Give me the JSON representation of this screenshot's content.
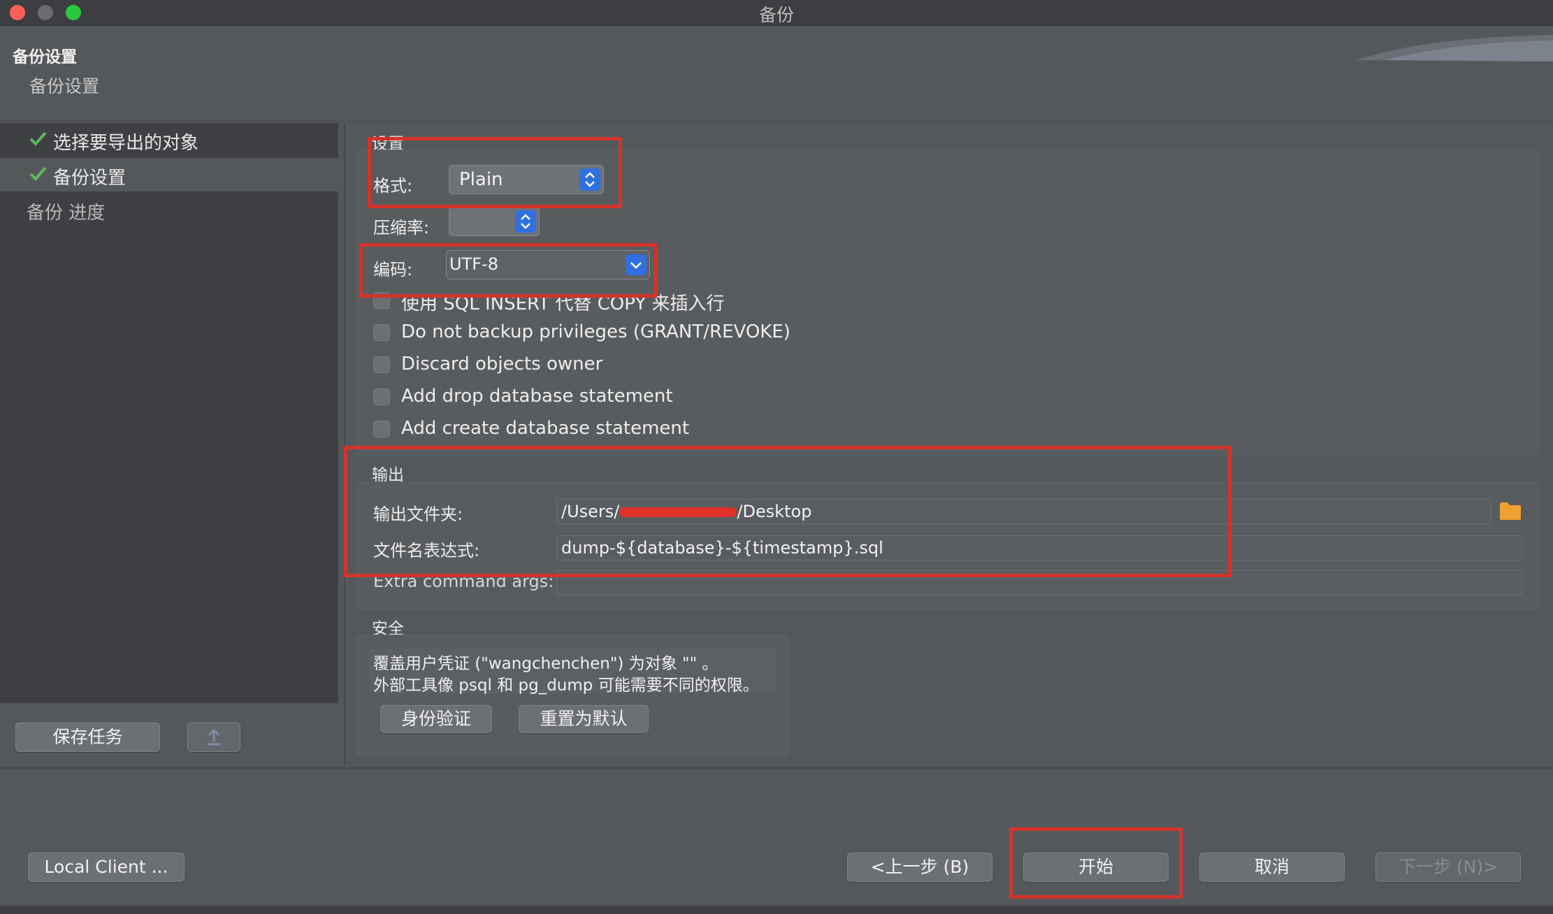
{
  "window": {
    "title": "备份"
  },
  "header": {
    "title": "备份设置",
    "subtitle": "备份设置"
  },
  "nav": {
    "items": [
      {
        "label": "选择要导出的对象",
        "done": true
      },
      {
        "label": "备份设置",
        "done": true
      },
      {
        "label": "备份 进度",
        "done": false
      }
    ],
    "save_task_label": "保存任务"
  },
  "settings": {
    "group_title": "设置",
    "format_label": "格式:",
    "format_value": "Plain",
    "compression_label": "压缩率:",
    "compression_value": "",
    "encoding_label": "编码:",
    "encoding_value": "UTF-8",
    "checkboxes": [
      {
        "label": "使用 SQL INSERT 代替 COPY 来插入行",
        "checked": false
      },
      {
        "label": "Do not backup privileges (GRANT/REVOKE)",
        "checked": false
      },
      {
        "label": "Discard objects owner",
        "checked": false
      },
      {
        "label": "Add drop database statement",
        "checked": false
      },
      {
        "label": "Add create database statement",
        "checked": false
      }
    ]
  },
  "output": {
    "group_title": "输出",
    "folder_label": "输出文件夹:",
    "folder_value": "/Users/wangchenchen/Desktop",
    "folder_value_prefix": "/Users/",
    "folder_value_suffix": "/Desktop",
    "filename_label": "文件名表达式:",
    "filename_value": "dump-${database}-${timestamp}.sql",
    "extra_label": "Extra command args:",
    "extra_value": ""
  },
  "security": {
    "group_title": "安全",
    "line1": "覆盖用户凭证 (\"wangchenchen\") 为对象 \"\" 。",
    "line2": "外部工具像 psql 和 pg_dump 可能需要不同的权限。",
    "auth_button": "身份验证",
    "reset_button": "重置为默认"
  },
  "footer": {
    "local_client": "Local Client ...",
    "back": "<上一步 (B)",
    "start": "开始",
    "cancel": "取消",
    "next": "下一步 (N)>"
  },
  "colors": {
    "highlight_border": "#d4332a",
    "check_green": "#5cb85c",
    "folder_orange": "#f0a030",
    "accent_blue": "#2f6fe0"
  }
}
